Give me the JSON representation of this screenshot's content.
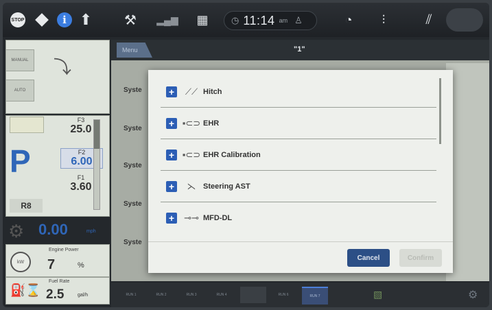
{
  "status_bar": {
    "stop_label": "STOP",
    "info_glyph": "i",
    "time": "11:14",
    "ampm": "am"
  },
  "left_panel": {
    "mode_manual": "MANUAL",
    "mode_auto": "AUTO",
    "gear_letter": "P",
    "range": "R8",
    "f3_label": "F3",
    "f3_value": "25.0",
    "f2_label": "F2",
    "f2_value": "6.00",
    "f1_label": "F1",
    "f1_value": "3.60",
    "speed": "0.00",
    "speed_unit": "mph",
    "speed_badge": "AUTO",
    "engine_label": "Engine Power",
    "engine_value": "7",
    "engine_unit": "%",
    "kw_badge": "kW",
    "fuel_label": "Fuel Rate",
    "fuel_value": "2.5",
    "fuel_unit": "gal/h"
  },
  "main": {
    "menu_tab": "Menu",
    "title": "\"1\"",
    "rows": [
      "Syste",
      "Syste",
      "Syste",
      "Syste",
      "Syste"
    ]
  },
  "modal": {
    "items": [
      {
        "label": "Hitch",
        "icon": "hitch-icon"
      },
      {
        "label": "EHR",
        "icon": "ehr-icon"
      },
      {
        "label": "EHR Calibration",
        "icon": "ehr-icon"
      },
      {
        "label": "Steering AST",
        "icon": "steering-icon"
      },
      {
        "label": "MFD-DL",
        "icon": "mfd-icon"
      }
    ],
    "cancel": "Cancel",
    "confirm": "Confirm"
  },
  "run_bar": {
    "tabs": [
      "RUN 1",
      "RUN 2",
      "RUN 3",
      "RUN 4",
      "",
      "RUN 6",
      "RUN 7"
    ],
    "active_tab": "RUN 7"
  }
}
